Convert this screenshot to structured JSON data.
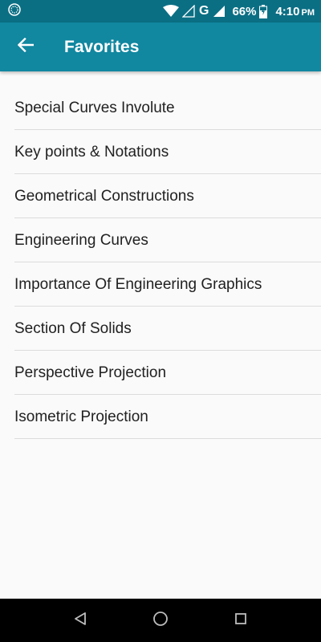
{
  "status_bar": {
    "battery": "66%",
    "time": "4:10",
    "ampm": "PM",
    "network": "G",
    "icons": [
      "app-notification-icon",
      "wifi-icon",
      "signal-empty-icon",
      "signal-icon",
      "battery-charging-icon"
    ]
  },
  "app_bar": {
    "title": "Favorites",
    "back_icon": "back-arrow-icon",
    "color": "#1187a0",
    "status_color": "#0b6f84"
  },
  "favorites": [
    {
      "label": "Special Curves Involute"
    },
    {
      "label": "Key points & Notations"
    },
    {
      "label": "Geometrical Constructions"
    },
    {
      "label": "Engineering Curves"
    },
    {
      "label": "Importance Of Engineering Graphics"
    },
    {
      "label": "Section Of Solids"
    },
    {
      "label": "Perspective Projection"
    },
    {
      "label": "Isometric Projection"
    }
  ],
  "nav_bar": {
    "icons": [
      "back-triangle-icon",
      "home-circle-icon",
      "recents-square-icon"
    ]
  }
}
